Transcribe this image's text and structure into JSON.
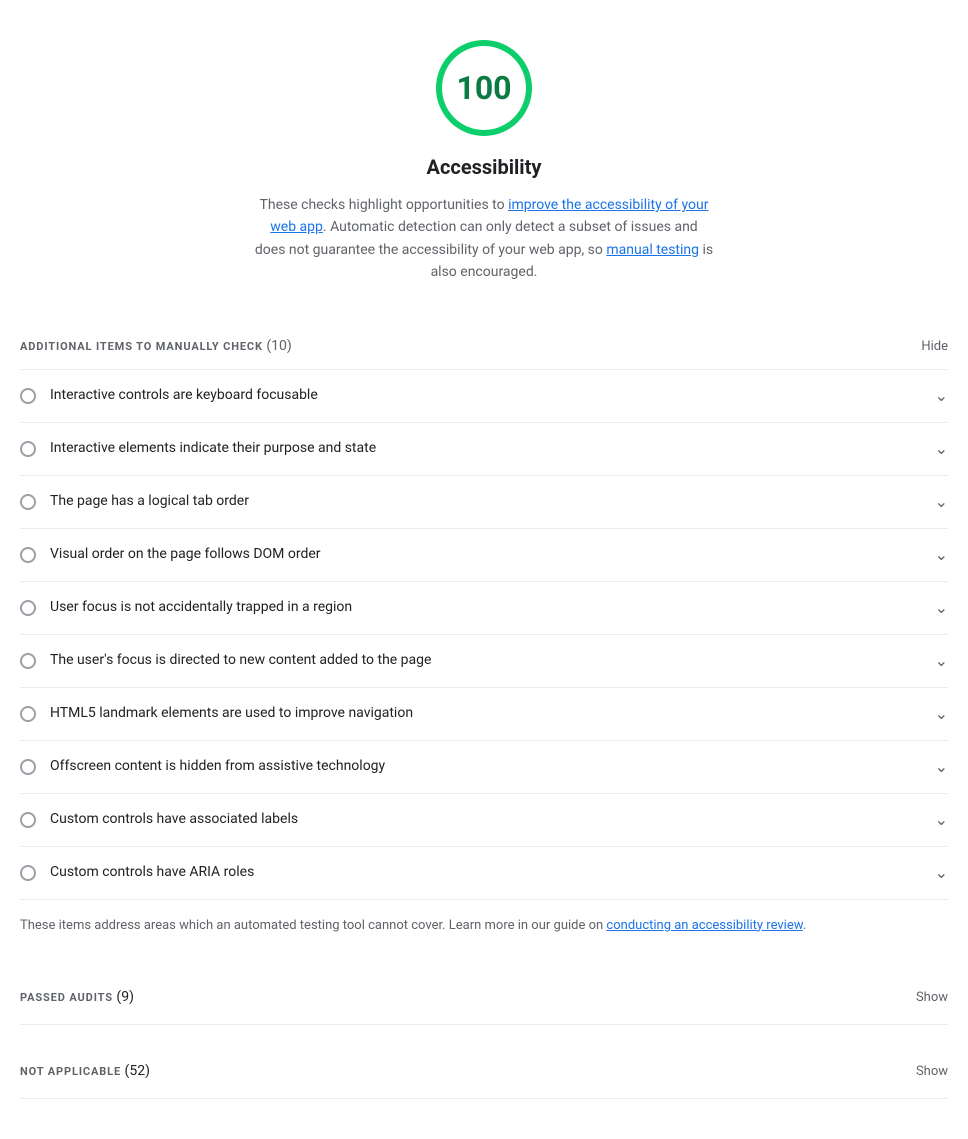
{
  "score": {
    "value": "100",
    "color": "#0cce6b",
    "text_color": "#0a7c42"
  },
  "title": "Accessibility",
  "description": {
    "prefix": "These checks highlight opportunities to ",
    "link1_text": "improve the accessibility of your web app",
    "link1_href": "#",
    "middle": ". Automatic detection can only detect a subset of issues and does not guarantee the accessibility of your web app, so ",
    "link2_text": "manual testing",
    "link2_href": "#",
    "suffix": " is also encouraged."
  },
  "manual_section": {
    "title": "ADDITIONAL ITEMS TO MANUALLY CHECK",
    "count": "(10)",
    "toggle_label": "Hide"
  },
  "audit_items": [
    {
      "label": "Interactive controls are keyboard focusable"
    },
    {
      "label": "Interactive elements indicate their purpose and state"
    },
    {
      "label": "The page has a logical tab order"
    },
    {
      "label": "Visual order on the page follows DOM order"
    },
    {
      "label": "User focus is not accidentally trapped in a region"
    },
    {
      "label": "The user's focus is directed to new content added to the page"
    },
    {
      "label": "HTML5 landmark elements are used to improve navigation"
    },
    {
      "label": "Offscreen content is hidden from assistive technology"
    },
    {
      "label": "Custom controls have associated labels"
    },
    {
      "label": "Custom controls have ARIA roles"
    }
  ],
  "footer_note": {
    "prefix": "These items address areas which an automated testing tool cannot cover. Learn more in our guide on ",
    "link_text": "conducting an accessibility review",
    "link_href": "#",
    "suffix": "."
  },
  "passed_section": {
    "title": "PASSED AUDITS",
    "count": "(9)",
    "toggle_label": "Show"
  },
  "not_applicable_section": {
    "title": "NOT APPLICABLE",
    "count": "(52)",
    "toggle_label": "Show"
  }
}
